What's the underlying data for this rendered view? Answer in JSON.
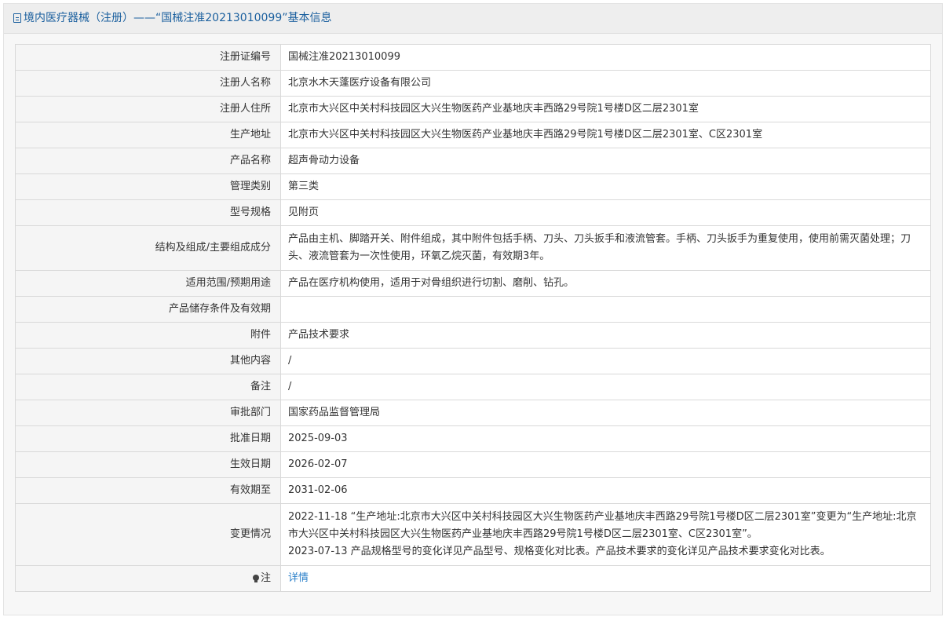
{
  "header": {
    "title": "境内医疗器械（注册）——“国械注准20213010099”基本信息"
  },
  "rows": [
    {
      "label": "注册证编号",
      "value": "国械注准20213010099"
    },
    {
      "label": "注册人名称",
      "value": "北京水木天蓬医疗设备有限公司"
    },
    {
      "label": "注册人住所",
      "value": "北京市大兴区中关村科技园区大兴生物医药产业基地庆丰西路29号院1号楼D区二层2301室"
    },
    {
      "label": "生产地址",
      "value": "北京市大兴区中关村科技园区大兴生物医药产业基地庆丰西路29号院1号楼D区二层2301室、C区2301室"
    },
    {
      "label": "产品名称",
      "value": "超声骨动力设备"
    },
    {
      "label": "管理类别",
      "value": "第三类"
    },
    {
      "label": "型号规格",
      "value": "见附页"
    },
    {
      "label": "结构及组成/主要组成成分",
      "value": "产品由主机、脚踏开关、附件组成，其中附件包括手柄、刀头、刀头扳手和液流管套。手柄、刀头扳手为重复使用，使用前需灭菌处理；刀头、液流管套为一次性使用，环氧乙烷灭菌，有效期3年。"
    },
    {
      "label": "适用范围/预期用途",
      "value": "产品在医疗机构使用，适用于对骨组织进行切割、磨削、钻孔。"
    },
    {
      "label": "产品储存条件及有效期",
      "value": ""
    },
    {
      "label": "附件",
      "value": "产品技术要求"
    },
    {
      "label": "其他内容",
      "value": "/"
    },
    {
      "label": "备注",
      "value": "/"
    },
    {
      "label": "审批部门",
      "value": "国家药品监督管理局"
    },
    {
      "label": "批准日期",
      "value": "2025-09-03"
    },
    {
      "label": "生效日期",
      "value": "2026-02-07"
    },
    {
      "label": "有效期至",
      "value": "2031-02-06"
    }
  ],
  "changes": {
    "label": "变更情况",
    "line1": "2022-11-18 “生产地址:北京市大兴区中关村科技园区大兴生物医药产业基地庆丰西路29号院1号楼D区二层2301室”变更为“生产地址:北京市大兴区中关村科技园区大兴生物医药产业基地庆丰西路29号院1号楼D区二层2301室、C区2301室”。",
    "line2": "2023-07-13 产品规格型号的变化详见产品型号、规格变化对比表。产品技术要求的变化详见产品技术要求变化对比表。"
  },
  "note": {
    "label": "注",
    "link": "详情",
    "icon": "bulb-icon"
  },
  "colors": {
    "header_text": "#1a5f9e",
    "link": "#2a7fc9",
    "label_bg": "#f5f5f5",
    "border": "#d9d9d9"
  }
}
